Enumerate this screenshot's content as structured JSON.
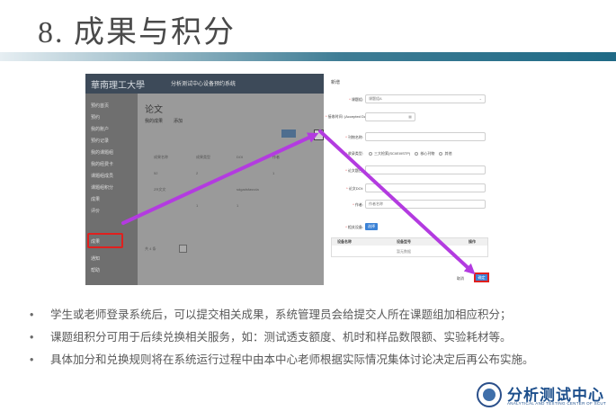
{
  "slide": {
    "title": "8. 成果与积分"
  },
  "left_screen": {
    "logo_text": "華南理工大學",
    "system_title": "分析测试中心设备预约系统",
    "sidebar": [
      "预约首页",
      "预约",
      "我的账户",
      "预约记录",
      "我的课题组",
      "我的经费卡",
      "课题组成员",
      "课题组积分",
      "成果",
      "评价",
      "通知",
      "帮助",
      "退出"
    ],
    "main_title": "论文",
    "subtabs": [
      "我的成果",
      "添加"
    ],
    "table_headers": [
      "成果名称",
      "成果类型",
      "DOI",
      "作者"
    ],
    "rows": [
      [
        "52",
        "2",
        "",
        "1"
      ],
      [
        "ZR文文",
        "2",
        "sdgadsfasvda",
        ""
      ],
      [
        "",
        "1",
        "1",
        ""
      ]
    ],
    "pager": "共 4 条"
  },
  "right_form": {
    "title": "新增",
    "fields": [
      {
        "label": "课题组:",
        "value": "课题组A",
        "required": true,
        "has_dropdown": true
      },
      {
        "label": "接收时间: (Accepted Date)",
        "value": "",
        "required": true,
        "has_dropdown": false
      },
      {
        "label": "刊物名称:",
        "value": "",
        "required": true,
        "has_dropdown": false
      },
      {
        "label": "论文题目:",
        "value": "",
        "required": true,
        "has_dropdown": false
      },
      {
        "label": "论文DOI:",
        "value": "",
        "required": true,
        "has_dropdown": false
      },
      {
        "label": "作者:",
        "value": "作者名称",
        "required": true,
        "has_dropdown": false
      }
    ],
    "radio_label": "收录类型:",
    "radio_options": [
      "三大检索(SCI/EI/ISTP)",
      "核心刊物",
      "其他"
    ],
    "device_label": "相关设备:",
    "select_button": "选择",
    "table_headers": [
      "设备名称",
      "设备型号",
      "操作"
    ],
    "empty_text": "暂无数据",
    "cancel": "取消",
    "confirm": "确定"
  },
  "bullets": [
    "学生或老师登录系统后，可以提交相关成果，系统管理员会给提交人所在课题组加相应积分；",
    "课题组积分可用于后续兑换相关服务，如：测试透支额度、机时和样品数限额、实验耗材等。",
    "具体加分和兑换规则将在系统运行过程中由本中心老师根据实际情况集体讨论决定后再公布实施。"
  ],
  "bullet_symbol": "•",
  "footer": {
    "logo_text": "分析测试中心",
    "logo_sub": "ANALYTICAL AND TESTING CENTER OF SCUT"
  },
  "colors": {
    "arrow": "#b33be0",
    "highlight": "#e0201e",
    "primary_button": "#3b82d6"
  }
}
